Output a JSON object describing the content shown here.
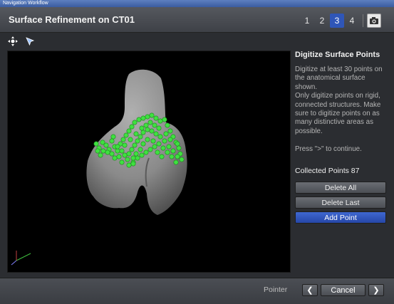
{
  "window": {
    "title": "Navigation Workflow"
  },
  "header": {
    "title": "Surface Refinement on CT01",
    "steps": [
      "1",
      "2",
      "3",
      "4"
    ],
    "active_step": "3",
    "camera_icon": "camera-icon"
  },
  "toolbar": {
    "icons": [
      "rotate-view-icon",
      "pointer-tool-icon"
    ]
  },
  "panel": {
    "title": "Digitize Surface Points",
    "instructions": [
      "Digitize at least 30 points on the anatomical surface shown.",
      "Only digitize points on rigid, connected structures. Make sure to digitize points on as many distinctive areas as possible.",
      "Press \">\" to continue."
    ],
    "collected_points": "Collected Points 87",
    "buttons": {
      "delete_all": "Delete All",
      "delete_last": "Delete Last",
      "add_point": "Add Point"
    }
  },
  "footer": {
    "tool": "Pointer",
    "back_icon": "chevron-left-icon",
    "cancel": "Cancel",
    "next_icon": "chevron-right-icon"
  },
  "colors": {
    "accent": "#2f56b8",
    "points": "#3fe040",
    "bone": "#8e8e8e"
  }
}
